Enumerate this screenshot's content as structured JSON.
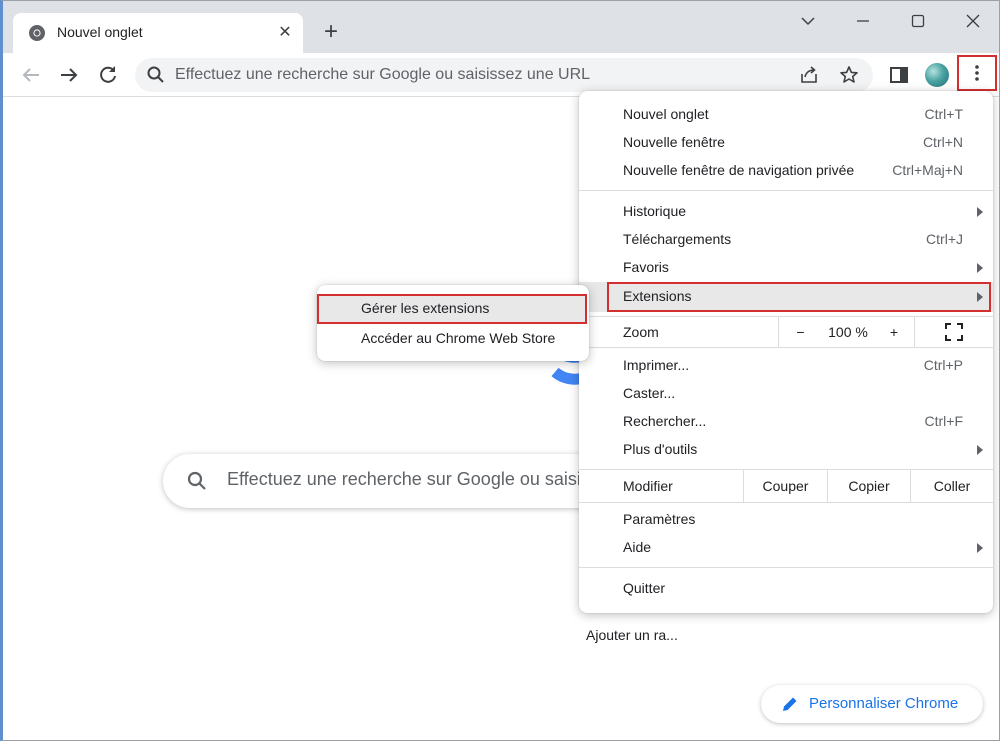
{
  "tab": {
    "title": "Nouvel onglet"
  },
  "omnibox": {
    "placeholder": "Effectuez une recherche sur Google ou saisissez une URL"
  },
  "search": {
    "placeholder": "Effectuez une recherche sur Google ou saisissez une URL"
  },
  "shortcut": {
    "label": "Ajouter un ra..."
  },
  "customize": {
    "label": "Personnaliser Chrome"
  },
  "menu": {
    "new_tab": {
      "label": "Nouvel onglet",
      "shortcut": "Ctrl+T"
    },
    "new_window": {
      "label": "Nouvelle fenêtre",
      "shortcut": "Ctrl+N"
    },
    "incognito": {
      "label": "Nouvelle fenêtre de navigation privée",
      "shortcut": "Ctrl+Maj+N"
    },
    "history": {
      "label": "Historique"
    },
    "downloads": {
      "label": "Téléchargements",
      "shortcut": "Ctrl+J"
    },
    "bookmarks": {
      "label": "Favoris"
    },
    "extensions": {
      "label": "Extensions"
    },
    "zoom": {
      "label": "Zoom",
      "minus": "−",
      "value": "100 %",
      "plus": "+"
    },
    "print": {
      "label": "Imprimer...",
      "shortcut": "Ctrl+P"
    },
    "cast": {
      "label": "Caster..."
    },
    "find": {
      "label": "Rechercher...",
      "shortcut": "Ctrl+F"
    },
    "more_tools": {
      "label": "Plus d'outils"
    },
    "edit": {
      "label": "Modifier",
      "cut": "Couper",
      "copy": "Copier",
      "paste": "Coller"
    },
    "settings": {
      "label": "Paramètres"
    },
    "help": {
      "label": "Aide"
    },
    "quit": {
      "label": "Quitter"
    }
  },
  "submenu": {
    "manage": "Gérer les extensions",
    "store": "Accéder au Chrome Web Store"
  },
  "colors": {
    "highlight_border": "#d32f2f",
    "link_blue": "#1a73e8"
  }
}
